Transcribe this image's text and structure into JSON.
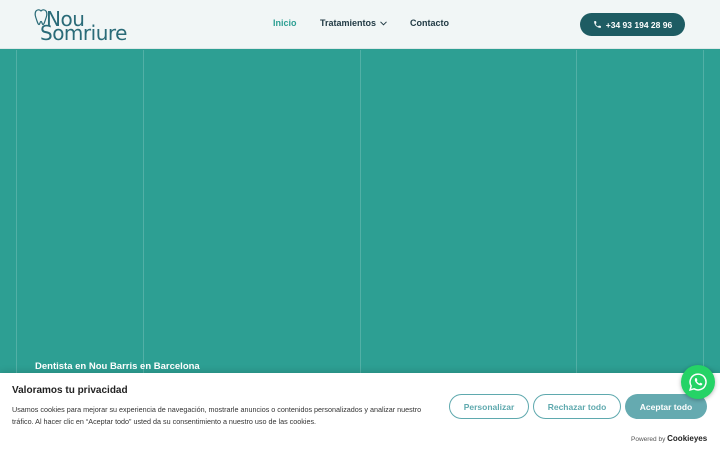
{
  "header": {
    "logo": {
      "line1": "Nou",
      "line2": "Somriure"
    },
    "nav": [
      {
        "label": "Inicio",
        "active": true
      },
      {
        "label": "Tratamientos",
        "active": false,
        "has_dropdown": true
      },
      {
        "label": "Contacto",
        "active": false
      }
    ],
    "phone_label": "+34 93 194 28 96"
  },
  "hero": {
    "caption": "Dentista en Nou Barris en Barcelona",
    "bg_color": "#2d9f93"
  },
  "cookie": {
    "title": "Valoramos tu privacidad",
    "text": "Usamos cookies para mejorar su experiencia de navegación, mostrarle anuncios o contenidos personalizados y analizar nuestro tráfico. Al hacer clic en “Aceptar todo” usted da su consentimiento a nuestro uso de las cookies.",
    "btn_personalizar": "Personalizar",
    "btn_rechazar": "Rechazar todo",
    "btn_aceptar": "Aceptar todo",
    "powered_by": "Powered by",
    "brand": "Cookieyes"
  },
  "icons": {
    "phone": "phone-icon",
    "whatsapp": "whatsapp-icon",
    "chevron": "chevron-down-icon"
  }
}
